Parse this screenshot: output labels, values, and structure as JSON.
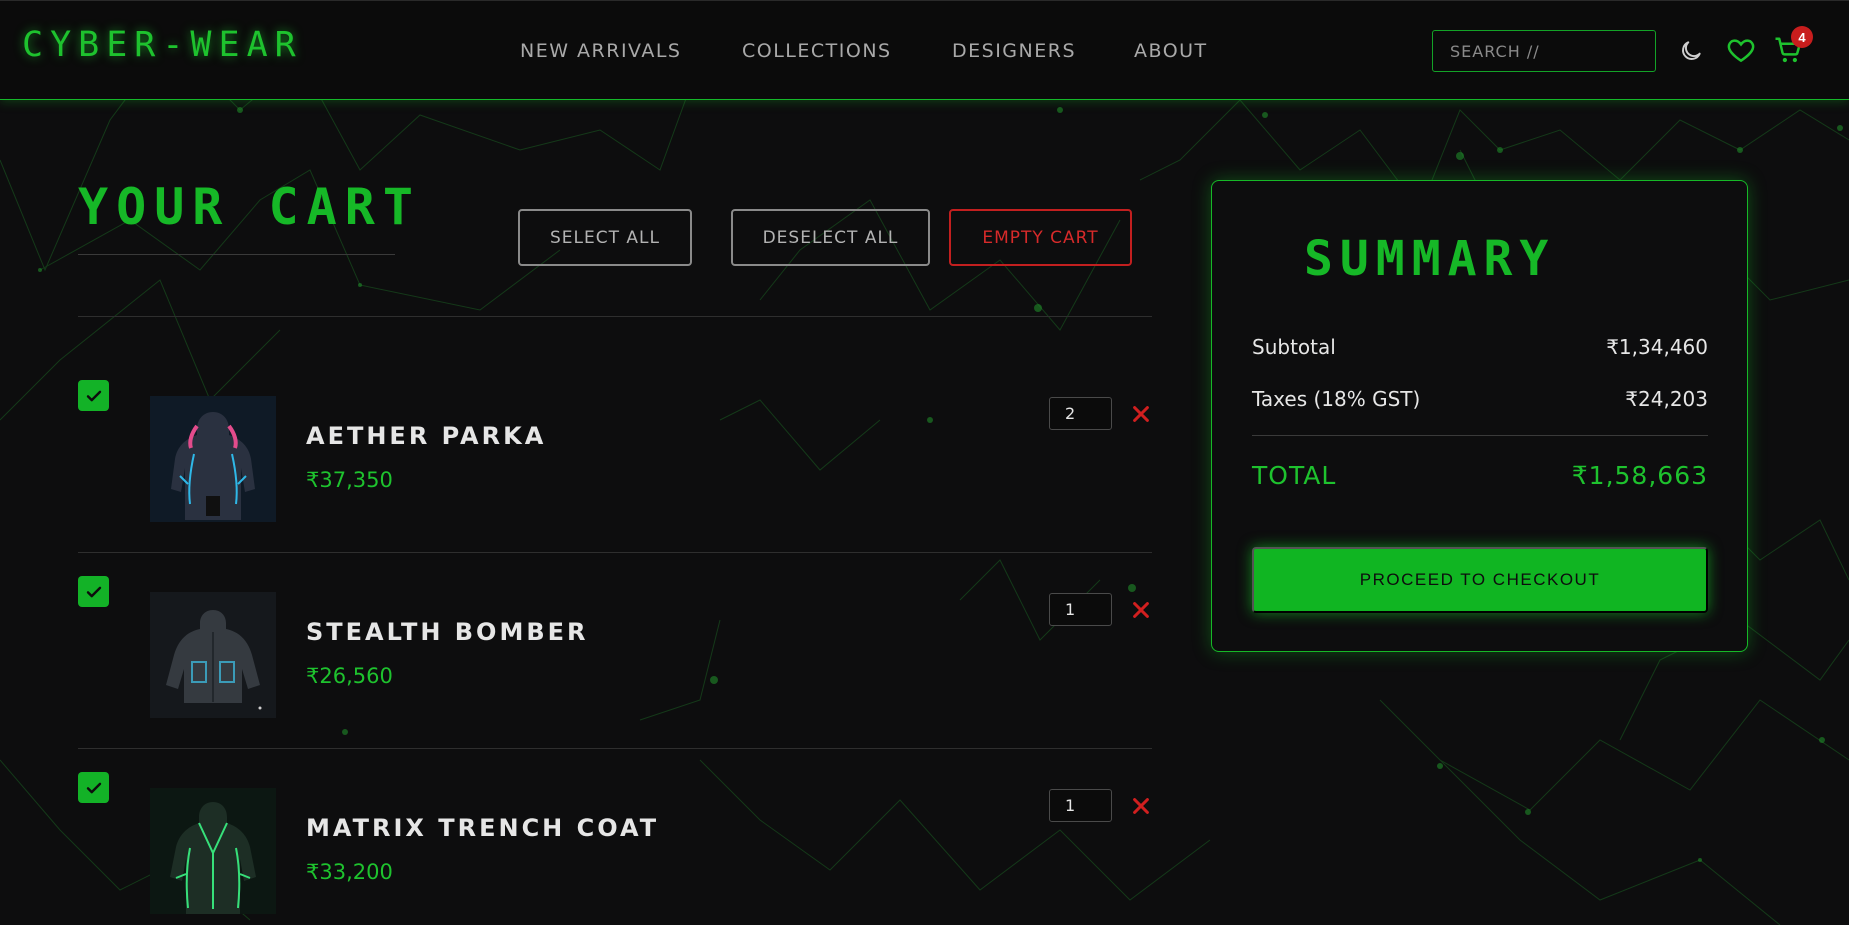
{
  "brand": {
    "logo": "CYBER-WEAR",
    "accent_color": "#16b827",
    "danger_color": "#c21f1f"
  },
  "nav": [
    {
      "label": "NEW ARRIVALS"
    },
    {
      "label": "COLLECTIONS"
    },
    {
      "label": "DESIGNERS"
    },
    {
      "label": "ABOUT"
    }
  ],
  "search": {
    "placeholder": "SEARCH //",
    "icon": "none"
  },
  "header_icons": {
    "theme": "moon-icon",
    "wishlist": "heart-icon",
    "cart": "cart-icon",
    "cart_count": "4"
  },
  "cart": {
    "title": "YOUR CART",
    "actions": {
      "select_all": "SELECT ALL",
      "deselect_all": "DESELECT ALL",
      "empty_cart": "EMPTY CART"
    },
    "items": [
      {
        "name": "AETHER PARKA",
        "price": "₹37,350",
        "quantity": "2",
        "selected": true
      },
      {
        "name": "STEALTH BOMBER",
        "price": "₹26,560",
        "quantity": "1",
        "selected": true
      },
      {
        "name": "MATRIX TRENCH COAT",
        "price": "₹33,200",
        "quantity": "1",
        "selected": true
      }
    ]
  },
  "summary": {
    "title": "SUMMARY",
    "subtotal_label": "Subtotal",
    "subtotal_value": "₹1,34,460",
    "tax_label": "Taxes (18% GST)",
    "tax_value": "₹24,203",
    "total_label": "TOTAL",
    "total_value": "₹1,58,663",
    "checkout_label": "PROCEED TO CHECKOUT"
  }
}
